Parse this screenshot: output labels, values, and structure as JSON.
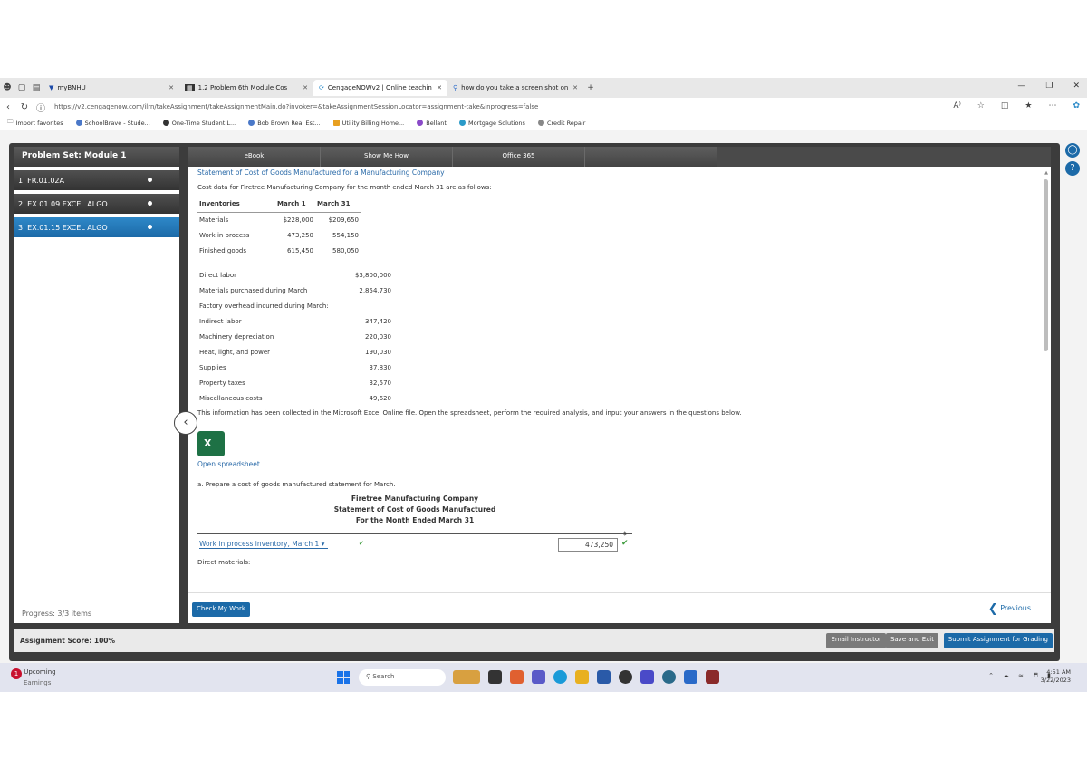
{
  "browser": {
    "tabs": [
      {
        "title": "myBNHU",
        "active": false
      },
      {
        "title": "1.2 Problem 6th Module Cos",
        "active": false
      },
      {
        "title": "CengageNOWv2 | Online teachin",
        "active": true
      },
      {
        "title": "how do you take a screen shot on",
        "active": false
      }
    ],
    "new_tab": "+",
    "url": "https://v2.cengagenow.com/ilrn/takeAssignment/takeAssignmentMain.do?invoker=&takeAssignmentSessionLocator=assignment-take&inprogress=false",
    "bookmarks": [
      "Import favorites",
      "SchoolBrave - Stude...",
      "One-Time Student L...",
      "Bob Brown Real Est...",
      "Utility Billing Home...",
      "Bellant",
      "Mortgage Solutions",
      "Credit Repair"
    ]
  },
  "app": {
    "problem_set_title": "Problem Set: Module 1",
    "left_items": [
      {
        "label": "1. FR.01.02A",
        "active": false
      },
      {
        "label": "2. EX.01.09 EXCEL ALGO",
        "active": false
      },
      {
        "label": "3. EX.01.15 EXCEL ALGO",
        "active": true
      }
    ],
    "progress": "Progress: 3/3 items",
    "top_tabs": [
      "eBook",
      "Show Me How",
      "Office 365",
      "",
      "",
      ""
    ],
    "content": {
      "heading": "Statement of Cost of Goods Manufactured for a Manufacturing Company",
      "intro": "Cost data for Firetree Manufacturing Company for the month ended March 31 are as follows:",
      "inventory_headers": [
        "Inventories",
        "March 1",
        "March 31"
      ],
      "inventories": [
        {
          "label": "Materials",
          "march1": "$228,000",
          "march31": "$209,650"
        },
        {
          "label": "Work in process",
          "march1": "473,250",
          "march31": "554,150"
        },
        {
          "label": "Finished goods",
          "march1": "615,450",
          "march31": "580,050"
        }
      ],
      "costs": [
        {
          "label": "Direct labor",
          "value": "$3,800,000"
        },
        {
          "label": "Materials purchased during March",
          "value": "2,854,730"
        }
      ],
      "overhead_title": "Factory overhead incurred during March:",
      "overhead": [
        {
          "label": "Indirect labor",
          "value": "347,420"
        },
        {
          "label": "Machinery depreciation",
          "value": "220,030"
        },
        {
          "label": "Heat, light, and power",
          "value": "190,030"
        },
        {
          "label": "Supplies",
          "value": "37,830"
        },
        {
          "label": "Property taxes",
          "value": "32,570"
        },
        {
          "label": "Miscellaneous costs",
          "value": "49,620"
        }
      ],
      "instruction": "This information has been collected in the Microsoft Excel Online file. Open the spreadsheet, perform the required analysis, and input your answers in the questions below.",
      "excel_icon": "X",
      "open_spreadsheet": "Open spreadsheet",
      "question_a": "a.  Prepare a cost of goods manufactured statement for March.",
      "statement_company": "Firetree Manufacturing Company",
      "statement_title": "Statement of Cost of Goods Manufactured",
      "statement_period": "For the Month Ended March 31",
      "wip_select": "Work in process inventory, March 1",
      "wip_value": "473,250",
      "direct_materials": "Direct materials:",
      "dollar": "$"
    },
    "check_my_work": "Check My Work",
    "previous": "Previous",
    "assignment_score": "Assignment Score: 100%",
    "footer_buttons": [
      "Email Instructor",
      "Save and Exit",
      "Submit Assignment for Grading"
    ]
  },
  "taskbar": {
    "weather_title": "Upcoming",
    "weather_sub": "Earnings",
    "badge": "1",
    "search": "Search",
    "time": "4:51 AM",
    "date": "3/22/2023"
  },
  "colors": {
    "accent": "#1c6aa8",
    "excel": "#1e7145",
    "check": "#3a9a3a"
  }
}
